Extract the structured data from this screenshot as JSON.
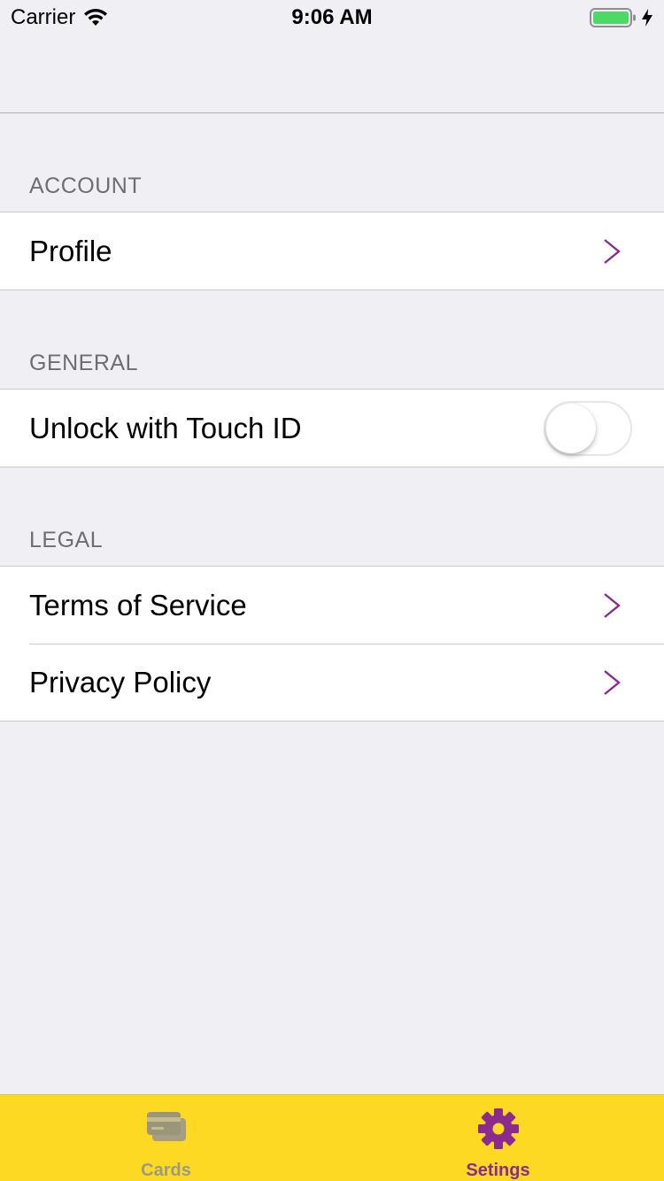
{
  "status_bar": {
    "carrier": "Carrier",
    "time": "9:06 AM",
    "battery_color": "#4cd964"
  },
  "sections": {
    "account": {
      "header": "ACCOUNT",
      "rows": [
        {
          "label": "Profile"
        }
      ]
    },
    "general": {
      "header": "GENERAL",
      "rows": [
        {
          "label": "Unlock with Touch ID",
          "toggle_on": false
        }
      ]
    },
    "legal": {
      "header": "LEGAL",
      "rows": [
        {
          "label": "Terms of Service"
        },
        {
          "label": "Privacy Policy"
        }
      ]
    }
  },
  "tab_bar": {
    "background": "#fdd923",
    "tabs": [
      {
        "label": "Cards",
        "icon": "credit-card-icon",
        "selected": false
      },
      {
        "label": "Setings",
        "icon": "gear-icon",
        "selected": true
      }
    ]
  },
  "colors": {
    "accent": "#8b2a8f",
    "chevron": "#8b2a8f"
  }
}
